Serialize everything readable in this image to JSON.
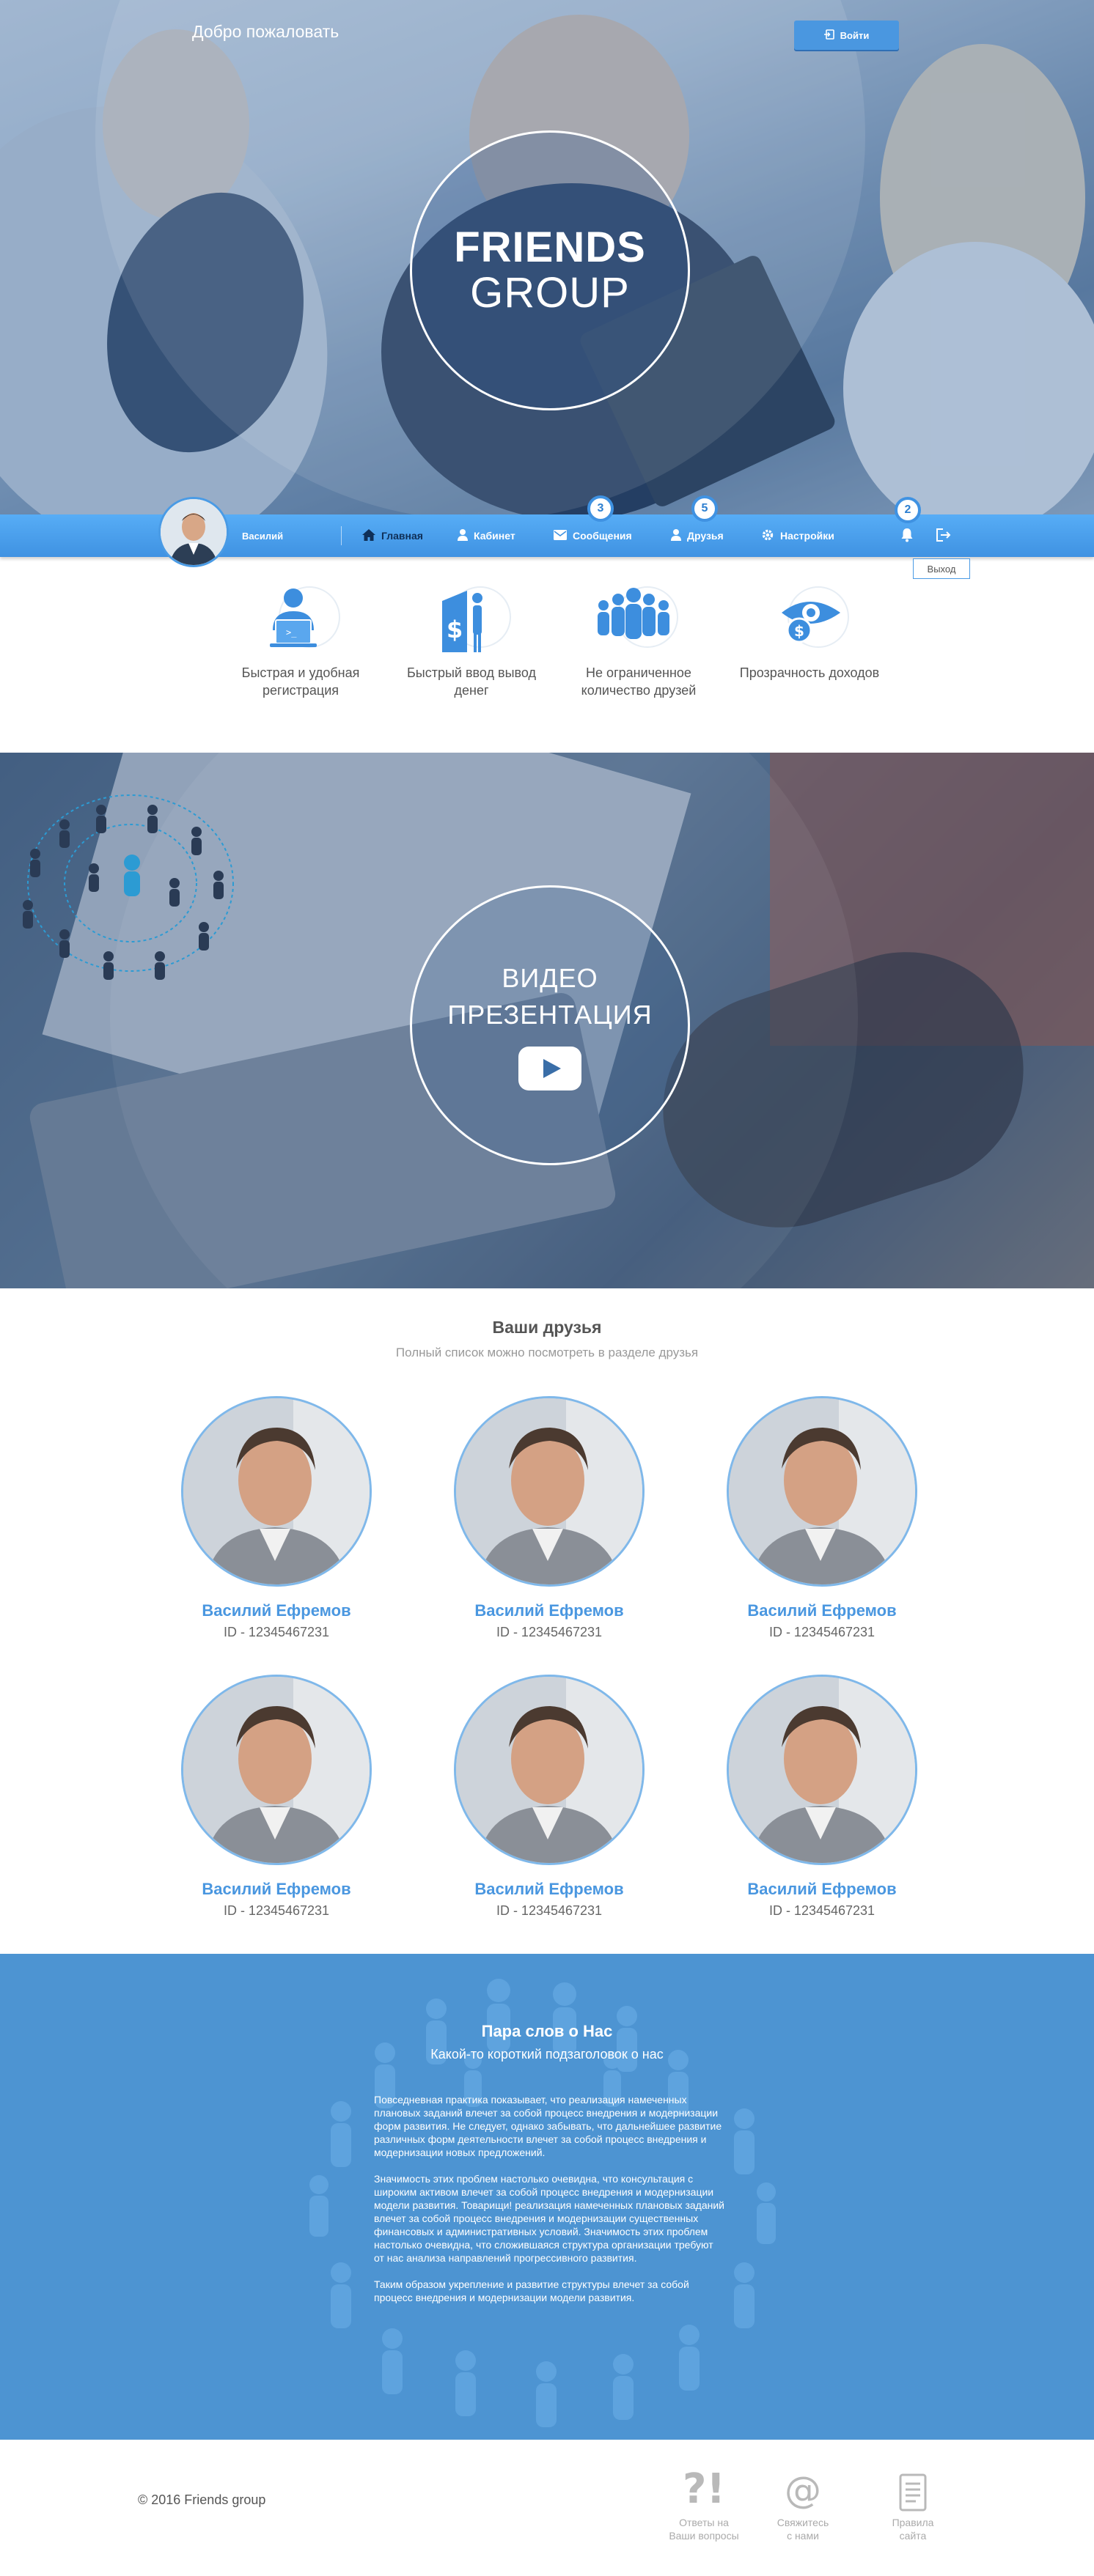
{
  "header": {
    "welcome": "Добро пожаловать",
    "login_label": "Войти",
    "logo_line1": "FRIENDS",
    "logo_line2": "GROUP"
  },
  "nav": {
    "user_name": "Василий",
    "items": [
      {
        "label": "Главная",
        "icon": "home-icon",
        "active": true
      },
      {
        "label": "Кабинет",
        "icon": "user-icon",
        "active": false
      },
      {
        "label": "Сообщения",
        "icon": "envelope-icon",
        "badge": "3",
        "active": false
      },
      {
        "label": "Друзья",
        "icon": "person-icon",
        "badge": "5",
        "active": false
      },
      {
        "label": "Настройки",
        "icon": "gear-icon",
        "active": false
      }
    ],
    "notifications_badge": "2",
    "logout_tooltip": "Выход"
  },
  "features": [
    {
      "label": "Быстрая и удобная регистрация",
      "icon": "registration-icon"
    },
    {
      "label": "Быстрый ввод вывод денег",
      "icon": "money-icon"
    },
    {
      "label": "Не ограниченное количество друзей",
      "icon": "group-icon"
    },
    {
      "label": "Прозрачность доходов",
      "icon": "eye-money-icon"
    }
  ],
  "video": {
    "line1": "ВИДЕО",
    "line2": "ПРЕЗЕНТАЦИЯ"
  },
  "friends": {
    "title": "Ваши друзья",
    "subtitle": "Полный список можно посмотреть в разделе друзья",
    "list": [
      {
        "name": "Василий Ефремов",
        "id": "ID - 12345467231"
      },
      {
        "name": "Василий Ефремов",
        "id": "ID - 12345467231"
      },
      {
        "name": "Василий Ефремов",
        "id": "ID - 12345467231"
      },
      {
        "name": "Василий Ефремов",
        "id": "ID - 12345467231"
      },
      {
        "name": "Василий Ефремов",
        "id": "ID - 12345467231"
      },
      {
        "name": "Василий Ефремов",
        "id": "ID - 12345467231"
      }
    ]
  },
  "about": {
    "title": "Пара слов о Нас",
    "subtitle": "Какой-то короткий подзаголовок о нас",
    "paragraphs": [
      "Повседневная практика показывает, что реализация намеченных плановых заданий влечет за собой процесс внедрения и модернизации форм развития. Не следует, однако забывать, что дальнейшее развитие различных форм деятельности влечет за собой процесс внедрения и модернизации новых предложений.",
      "Значимость этих проблем настолько очевидна, что консультация с широким активом влечет за собой процесс внедрения и модернизации модели развития. Товарищи! реализация намеченных плановых заданий влечет за собой процесс внедрения и модернизации существенных финансовых и административных условий. Значимость этих проблем настолько очевидна, что сложившаяся структура организации требуют от нас анализа направлений прогрессивного развития.",
      "Таким образом укрепление и развитие структуры влечет за собой процесс внедрения и модернизации модели развития."
    ]
  },
  "footer": {
    "copyright": "© 2016 Friends group",
    "links": [
      {
        "line1": "Ответы на",
        "line2": "Ваши вопросы",
        "icon": "question-icon"
      },
      {
        "line1": "Свяжитесь",
        "line2": "с нами",
        "icon": "at-icon"
      },
      {
        "line1": "Правила",
        "line2": "сайта",
        "icon": "document-icon"
      }
    ]
  },
  "colors": {
    "accent": "#4a97e0",
    "nav_bar": "#4a9fec",
    "about_bg": "#4d94d2"
  }
}
